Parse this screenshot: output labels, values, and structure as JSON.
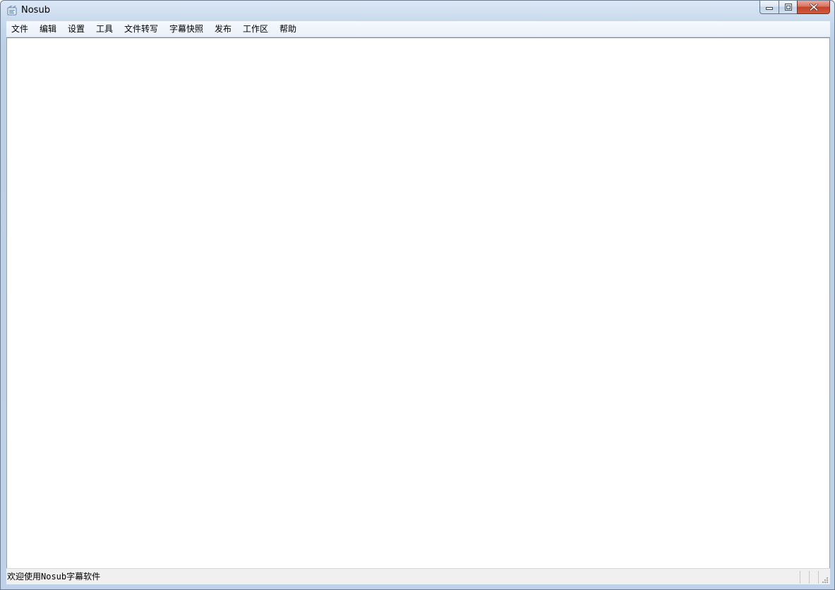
{
  "window": {
    "title": "Nosub"
  },
  "menu": {
    "items": [
      {
        "label": "文件"
      },
      {
        "label": "编辑"
      },
      {
        "label": "设置"
      },
      {
        "label": "工具"
      },
      {
        "label": "文件转写"
      },
      {
        "label": "字幕快照"
      },
      {
        "label": "发布"
      },
      {
        "label": "工作区"
      },
      {
        "label": "帮助"
      }
    ]
  },
  "statusbar": {
    "message": "欢迎使用Nosub字幕软件"
  },
  "icons": {
    "app": "app-icon",
    "minimize": "minimize-icon",
    "maximize": "maximize-icon",
    "close": "close-icon",
    "resize_grip": "resize-grip-icon"
  },
  "colors": {
    "titlebar": "#c9daee",
    "close_button": "#c2432b",
    "client_background": "#ffffff",
    "statusbar": "#f0f0f0"
  }
}
